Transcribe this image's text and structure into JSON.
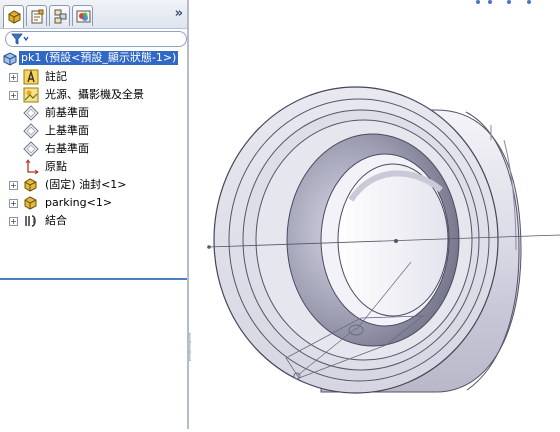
{
  "tabs": [
    {
      "name": "feature-manager-tab",
      "active": true
    },
    {
      "name": "property-manager-tab",
      "active": false
    },
    {
      "name": "configuration-manager-tab",
      "active": false
    },
    {
      "name": "display-manager-tab",
      "active": false
    }
  ],
  "tree": {
    "root": "pk1 (預設<預設_顯示狀態-1>)",
    "items": [
      {
        "label": "註記",
        "expandable": true,
        "icon": "annotation-icon"
      },
      {
        "label": "光源、攝影機及全景",
        "expandable": true,
        "icon": "lights-cameras-icon"
      },
      {
        "label": "前基準面",
        "expandable": false,
        "icon": "plane-icon"
      },
      {
        "label": "上基準面",
        "expandable": false,
        "icon": "plane-icon"
      },
      {
        "label": "右基準面",
        "expandable": false,
        "icon": "plane-icon"
      },
      {
        "label": "原點",
        "expandable": false,
        "icon": "origin-icon"
      },
      {
        "label": "(固定) 油封<1>",
        "expandable": true,
        "icon": "part-icon"
      },
      {
        "label": "parking<1>",
        "expandable": true,
        "icon": "part-icon"
      },
      {
        "label": "結合",
        "expandable": true,
        "icon": "mates-icon"
      }
    ]
  },
  "colors": {
    "selection": "#3168c6",
    "panel_border": "#b3bccb",
    "accent_line": "#4f7ec0"
  }
}
